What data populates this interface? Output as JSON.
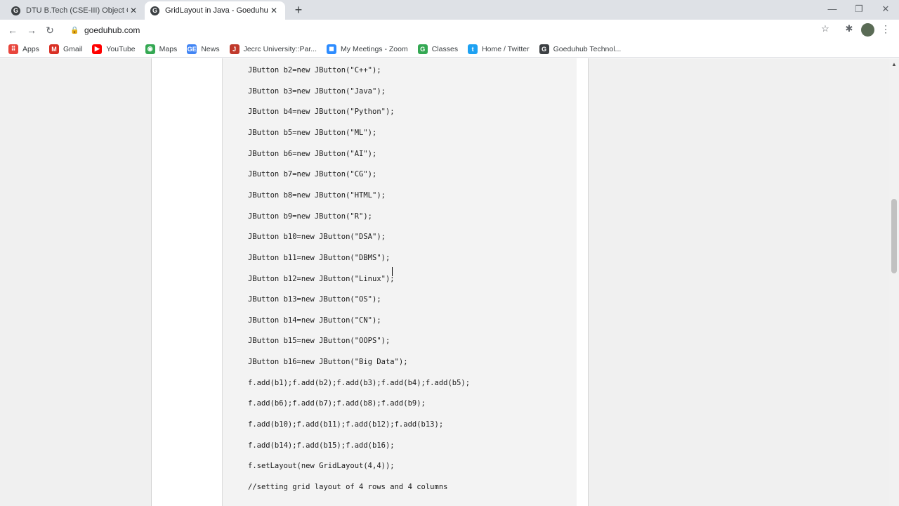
{
  "tabs": [
    {
      "title": "DTU B.Tech (CSE-III) Object Orien",
      "favicon": "G",
      "close": "✕"
    },
    {
      "title": "GridLayout in Java - Goeduhub T",
      "favicon": "G",
      "close": "✕"
    }
  ],
  "new_tab_label": "+",
  "window_controls": {
    "minimize": "—",
    "maximize": "❐",
    "close": "✕"
  },
  "toolbar": {
    "back": "←",
    "forward": "→",
    "reload": "↻",
    "lock": "🔒",
    "url": "goeduhub.com",
    "star": "☆",
    "extensions": "✱",
    "menu": "⋮"
  },
  "bookmarks": [
    {
      "label": "Apps",
      "icon": "apps-grid-icon",
      "color": "#e8453c",
      "glyph": "⠿"
    },
    {
      "label": "Gmail",
      "icon": "gmail-icon",
      "color": "#d93025",
      "glyph": "M"
    },
    {
      "label": "YouTube",
      "icon": "youtube-icon",
      "color": "#ff0000",
      "glyph": "▶"
    },
    {
      "label": "Maps",
      "icon": "maps-pin-icon",
      "color": "#34a853",
      "glyph": "◉"
    },
    {
      "label": "News",
      "icon": "news-icon",
      "color": "#4285f4",
      "glyph": "GE"
    },
    {
      "label": "Jecrc University::Par...",
      "icon": "jecrc-icon",
      "color": "#c0392b",
      "glyph": "J"
    },
    {
      "label": "My Meetings - Zoom",
      "icon": "zoom-icon",
      "color": "#2d8cff",
      "glyph": "◼"
    },
    {
      "label": "Classes",
      "icon": "google-classes-icon",
      "color": "#34a853",
      "glyph": "G"
    },
    {
      "label": "Home / Twitter",
      "icon": "twitter-icon",
      "color": "#1da1f2",
      "glyph": "t"
    },
    {
      "label": "Goeduhub Technol...",
      "icon": "goeduhub-icon",
      "color": "#3c4043",
      "glyph": "G"
    }
  ],
  "code_lines": [
    "JButton b2=new JButton(\"C++\");",
    "JButton b3=new JButton(\"Java\");",
    "JButton b4=new JButton(\"Python\");",
    "JButton b5=new JButton(\"ML\");",
    "JButton b6=new JButton(\"AI\");",
    "JButton b7=new JButton(\"CG\");",
    "JButton b8=new JButton(\"HTML\");",
    "JButton b9=new JButton(\"R\");",
    "JButton b10=new JButton(\"DSA\");",
    "JButton b11=new JButton(\"DBMS\");",
    "JButton b12=new JButton(\"Linux\");",
    "JButton b13=new JButton(\"OS\");",
    "JButton b14=new JButton(\"CN\");",
    "JButton b15=new JButton(\"OOPS\");",
    "JButton b16=new JButton(\"Big Data\");",
    "f.add(b1);f.add(b2);f.add(b3);f.add(b4);f.add(b5);",
    "f.add(b6);f.add(b7);f.add(b8);f.add(b9);",
    "f.add(b10);f.add(b11);f.add(b12);f.add(b13);",
    "f.add(b14);f.add(b15);f.add(b16);",
    "f.setLayout(new GridLayout(4,4));",
    "//setting grid layout of 4 rows and 4 columns"
  ],
  "scroll": {
    "up_arrow": "▲",
    "position_fraction": 0.37
  }
}
